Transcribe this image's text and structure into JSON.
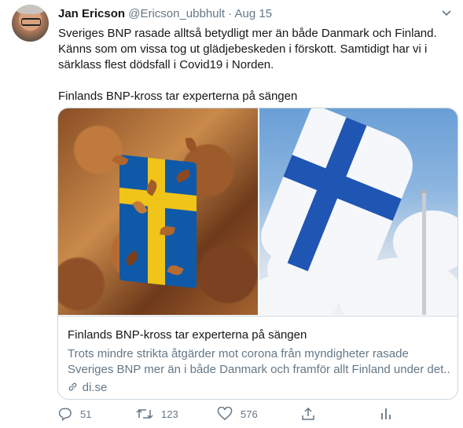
{
  "tweet": {
    "author_name": "Jan Ericson",
    "handle": "@Ericson_ubbhult",
    "separator": "·",
    "date": "Aug 15",
    "text": "Sveriges BNP rasade alltså betydligt mer än både Danmark och Finland.\nKänns som om vissa tog ut glädjebeskeden i förskott. Samtidigt har vi i\nsärklass flest dödsfall i Covid19 i Norden.\n\nFinlands BNP-kross tar experterna på sängen"
  },
  "card": {
    "title": "Finlands BNP-kross tar experterna på sängen",
    "description_line1": "Trots mindre strikta åtgärder mot corona från myndigheter rasade",
    "description_line2": "Sveriges BNP mer än i både Danmark och framför allt Finland under det...",
    "domain": "di.se",
    "link_icon": "link-icon"
  },
  "actions": {
    "reply_count": "51",
    "retweet_count": "123",
    "like_count": "576",
    "reply_icon": "reply-icon",
    "retweet_icon": "retweet-icon",
    "like_icon": "heart-icon",
    "share_icon": "share-icon",
    "analytics_icon": "analytics-icon"
  },
  "menu_icon": "chevron-down-icon",
  "colors": {
    "text_primary": "#14171a",
    "text_secondary": "#657786",
    "border": "#ccd6dd"
  }
}
